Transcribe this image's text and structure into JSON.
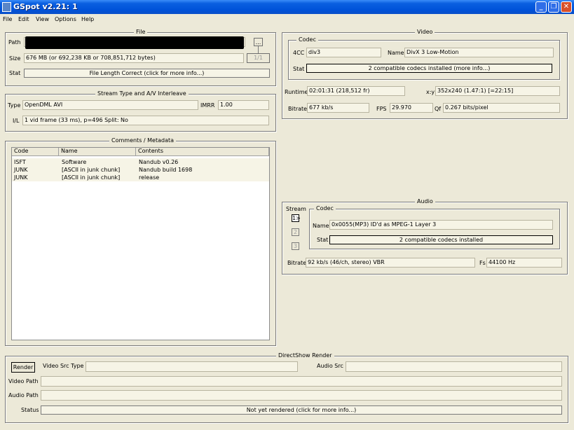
{
  "window": {
    "title": "GSpot v2.21: 1",
    "min_label": "_",
    "max_label": "❐",
    "close_label": "✕"
  },
  "menu": [
    "File",
    "Edit",
    "View",
    "Options",
    "Help"
  ],
  "file": {
    "legend": "File",
    "path_label": "Path",
    "browse_label": "...",
    "page_label": "1/1",
    "size_label": "Size",
    "size_value": "676 MB (or 692,238 KB or 708,851,712 bytes)",
    "stat_label": "Stat",
    "stat_value": "File Length Correct (click for more info...)"
  },
  "stream": {
    "legend": "Stream Type and A/V Interleave",
    "type_label": "Type",
    "type_value": "OpenDML AVI",
    "imrr_label": "IMRR",
    "imrr_value": "1.00",
    "il_label": "I/L",
    "il_value": "1 vid frame (33 ms), p=496  Split: No"
  },
  "comments": {
    "legend": "Comments / Metadata",
    "headers": [
      "Code",
      "Name",
      "Contents"
    ],
    "rows": [
      {
        "code": "ISFT",
        "name": "Software",
        "contents": "Nandub v0.26"
      },
      {
        "code": "JUNK",
        "name": "[ASCII in junk chunk]",
        "contents": "Nandub build 1698"
      },
      {
        "code": "JUNK",
        "name": "[ASCII in junk chunk]",
        "contents": "release"
      }
    ]
  },
  "video": {
    "legend": "Video",
    "codec_legend": "Codec",
    "fourcc_label": "4CC",
    "fourcc_value": "div3",
    "name_label": "Name",
    "name_value": "DivX 3 Low-Motion",
    "stat_label": "Stat",
    "stat_value": "2 compatible codecs installed (more info...)",
    "runtime_label": "Runtime",
    "runtime_value": "02:01:31 (218,512 fr)",
    "xy_label": "x:y",
    "xy_value": "352x240 (1.47:1) [=22:15]",
    "bitrate_label": "Bitrate",
    "bitrate_value": "677 kb/s",
    "fps_label": "FPS",
    "fps_value": "29.970",
    "qf_label": "Qf",
    "qf_value": "0.267 bits/pixel"
  },
  "audio": {
    "legend": "Audio",
    "stream_label": "Stream",
    "stream_buttons": [
      "1>",
      "2",
      "3"
    ],
    "codec_legend": "Codec",
    "name_label": "Name",
    "name_value": "0x0055(MP3) ID'd as MPEG-1 Layer 3",
    "stat_label": "Stat",
    "stat_value": "2 compatible codecs installed",
    "bitrate_label": "Bitrate",
    "bitrate_value": "92 kb/s (46/ch, stereo) VBR",
    "fs_label": "Fs",
    "fs_value": "44100 Hz"
  },
  "render": {
    "legend": "DirectShow Render",
    "render_button": "Render",
    "video_src_label": "Video Src Type",
    "video_src_value": "",
    "audio_src_label": "Audio Src",
    "audio_src_value": "",
    "video_path_label": "Video Path",
    "video_path_value": "",
    "audio_path_label": "Audio Path",
    "audio_path_value": "",
    "status_label": "Status",
    "status_value": "Not yet rendered (click for more info...)"
  }
}
